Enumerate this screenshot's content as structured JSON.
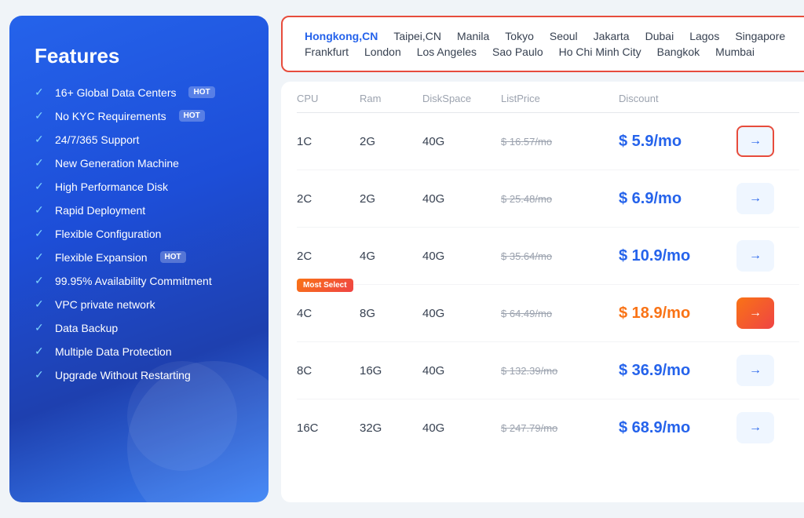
{
  "leftPanel": {
    "title": "Features",
    "features": [
      {
        "id": "global-dc",
        "text": "16+ Global Data Centers",
        "badge": "HOT"
      },
      {
        "id": "no-kyc",
        "text": "No KYC Requirements",
        "badge": "HOT"
      },
      {
        "id": "support",
        "text": "24/7/365 Support",
        "badge": null
      },
      {
        "id": "new-gen",
        "text": "New Generation Machine",
        "badge": null
      },
      {
        "id": "high-disk",
        "text": "High Performance Disk",
        "badge": null
      },
      {
        "id": "rapid",
        "text": "Rapid Deployment",
        "badge": null
      },
      {
        "id": "flexible-config",
        "text": "Flexible Configuration",
        "badge": null
      },
      {
        "id": "flexible-exp",
        "text": "Flexible Expansion",
        "badge": "HOT"
      },
      {
        "id": "availability",
        "text": "99.95% Availability Commitment",
        "badge": null
      },
      {
        "id": "vpc",
        "text": "VPC private network",
        "badge": null
      },
      {
        "id": "backup",
        "text": "Data Backup",
        "badge": null
      },
      {
        "id": "multi-protect",
        "text": "Multiple Data Protection",
        "badge": null
      },
      {
        "id": "no-restart",
        "text": "Upgrade Without Restarting",
        "badge": null
      }
    ]
  },
  "locations": {
    "row1": [
      {
        "id": "hongkong",
        "label": "Hongkong,CN",
        "active": true
      },
      {
        "id": "taipei",
        "label": "Taipei,CN",
        "active": false
      },
      {
        "id": "manila",
        "label": "Manila",
        "active": false
      },
      {
        "id": "tokyo",
        "label": "Tokyo",
        "active": false
      },
      {
        "id": "seoul",
        "label": "Seoul",
        "active": false
      },
      {
        "id": "jakarta",
        "label": "Jakarta",
        "active": false
      },
      {
        "id": "dubai",
        "label": "Dubai",
        "active": false
      },
      {
        "id": "lagos",
        "label": "Lagos",
        "active": false
      },
      {
        "id": "singapore",
        "label": "Singapore",
        "active": false
      }
    ],
    "row2": [
      {
        "id": "frankfurt",
        "label": "Frankfurt",
        "active": false
      },
      {
        "id": "london",
        "label": "London",
        "active": false
      },
      {
        "id": "los-angeles",
        "label": "Los Angeles",
        "active": false
      },
      {
        "id": "sao-paulo",
        "label": "Sao Paulo",
        "active": false
      },
      {
        "id": "ho-chi-minh",
        "label": "Ho Chi Minh City",
        "active": false
      },
      {
        "id": "bangkok",
        "label": "Bangkok",
        "active": false
      },
      {
        "id": "mumbai",
        "label": "Mumbai",
        "active": false
      }
    ]
  },
  "table": {
    "headers": {
      "cpu": "CPU",
      "ram": "Ram",
      "disk": "DiskSpace",
      "listPrice": "ListPrice",
      "discount": "Discount"
    },
    "rows": [
      {
        "id": "row-1",
        "cpu": "1C",
        "ram": "2G",
        "disk": "40G",
        "listPrice": "$ 16.57/mo",
        "discountPrice": "$ 5.9/mo",
        "highlighted": true,
        "hot": false,
        "mostSelect": false
      },
      {
        "id": "row-2",
        "cpu": "2C",
        "ram": "2G",
        "disk": "40G",
        "listPrice": "$ 25.48/mo",
        "discountPrice": "$ 6.9/mo",
        "highlighted": false,
        "hot": false,
        "mostSelect": false
      },
      {
        "id": "row-3",
        "cpu": "2C",
        "ram": "4G",
        "disk": "40G",
        "listPrice": "$ 35.64/mo",
        "discountPrice": "$ 10.9/mo",
        "highlighted": false,
        "hot": false,
        "mostSelect": false
      },
      {
        "id": "row-4",
        "cpu": "4C",
        "ram": "8G",
        "disk": "40G",
        "listPrice": "$ 64.49/mo",
        "discountPrice": "$ 18.9/mo",
        "highlighted": false,
        "hot": true,
        "mostSelect": true
      },
      {
        "id": "row-5",
        "cpu": "8C",
        "ram": "16G",
        "disk": "40G",
        "listPrice": "$ 132.39/mo",
        "discountPrice": "$ 36.9/mo",
        "highlighted": false,
        "hot": false,
        "mostSelect": false
      },
      {
        "id": "row-6",
        "cpu": "16C",
        "ram": "32G",
        "disk": "40G",
        "listPrice": "$ 247.79/mo",
        "discountPrice": "$ 68.9/mo",
        "highlighted": false,
        "hot": false,
        "mostSelect": false
      }
    ],
    "mostSelectLabel": "Most Select",
    "arrowSymbol": "→"
  }
}
